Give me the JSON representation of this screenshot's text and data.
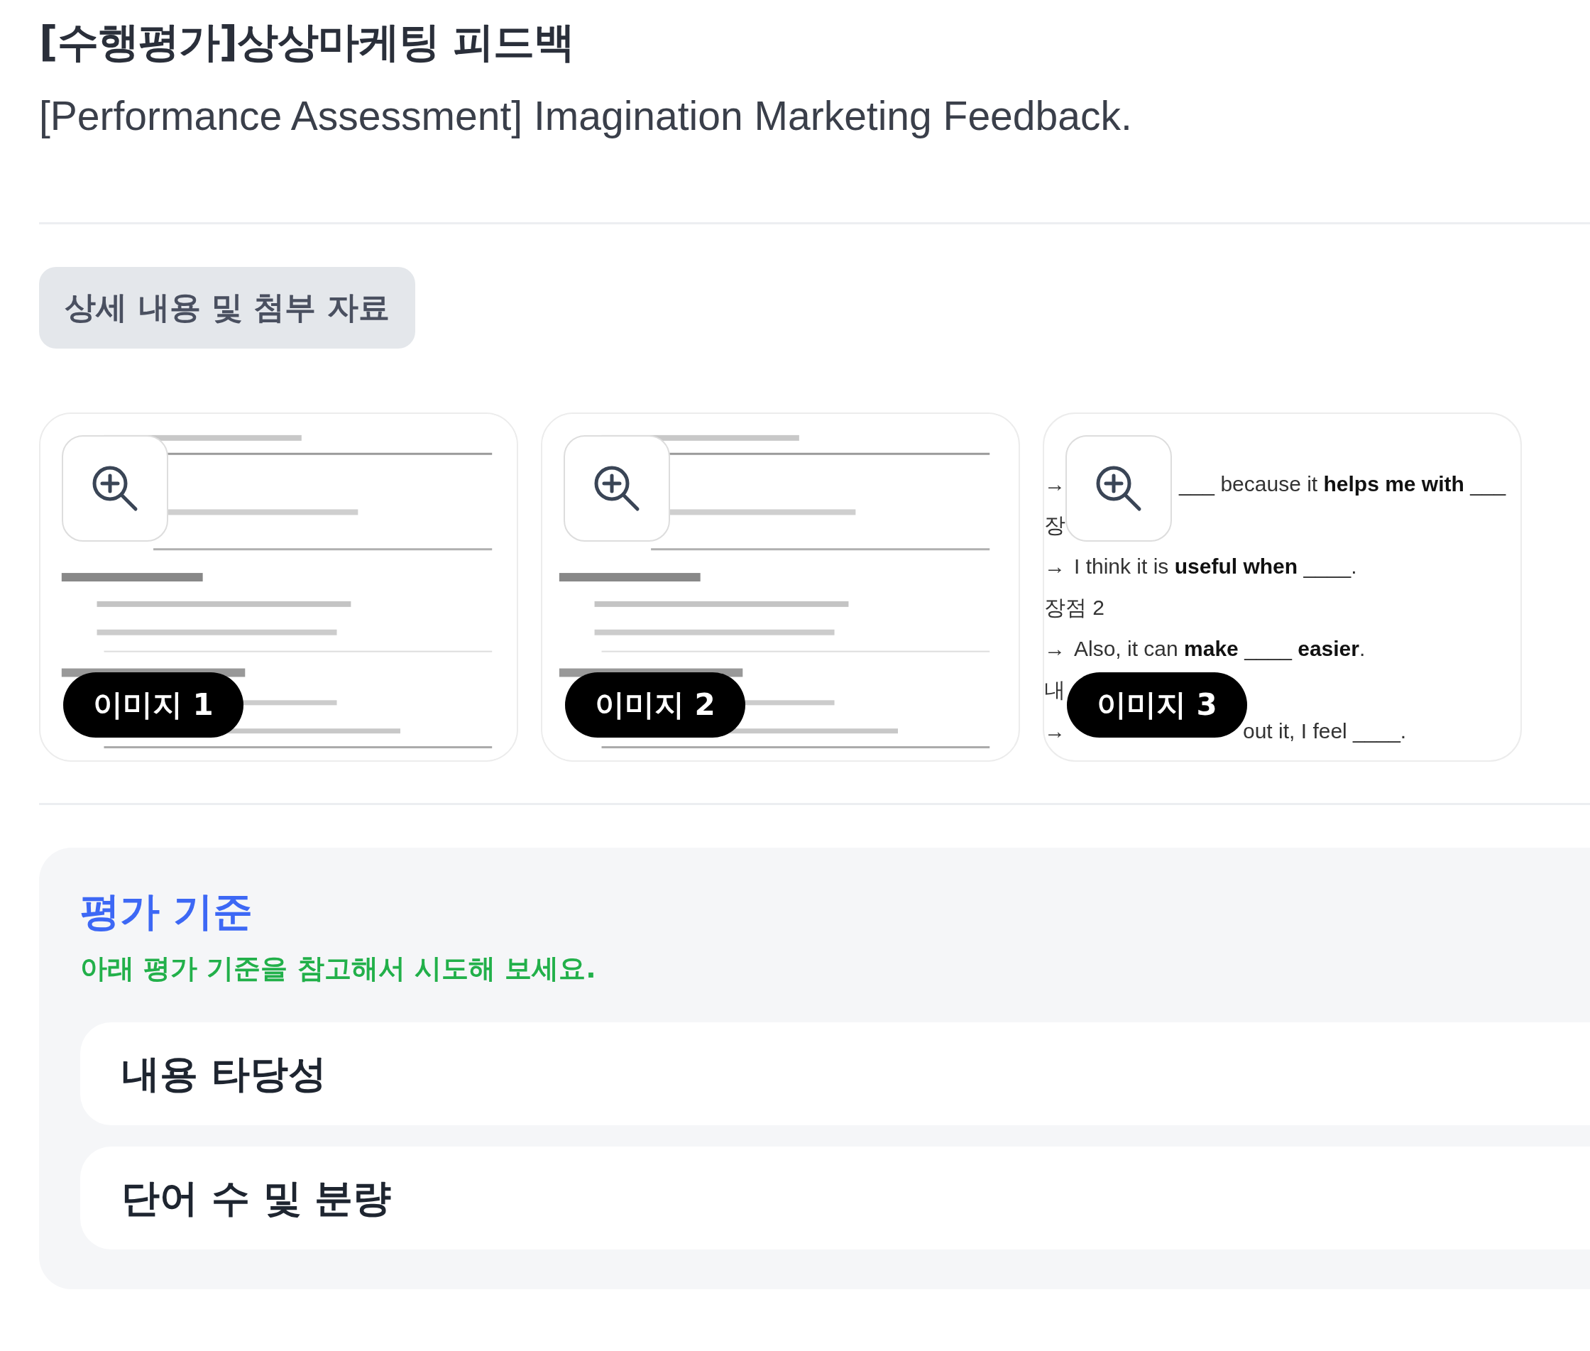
{
  "title": "[수행평가]상상마케팅 피드백",
  "subtitle": "[Performance Assessment] Imagination Marketing Feedback.",
  "details_button": "상세 내용 및 첨부 자료",
  "images": [
    {
      "kind": "picture",
      "badge": "이미지 1"
    },
    {
      "kind": "picture",
      "badge": "이미지 2"
    },
    {
      "kind": "document",
      "badge": "이미지 3",
      "lines": [
        {
          "lead": "→",
          "text": "___ because it **helps me with** ___"
        },
        {
          "lead": "장"
        },
        {
          "lead": "→",
          "text": "I think it is **useful when** ____."
        },
        {
          "lead": "장점 2"
        },
        {
          "lead": "→",
          "text": "Also, it can **make** ____ **easier**."
        },
        {
          "lead": "내"
        },
        {
          "lead": "→",
          "text": "out it, I feel ____."
        }
      ]
    }
  ],
  "criteria": {
    "heading": "평가 기준",
    "note": "아래 평가 기준을 참고해서 시도해 보세요.",
    "items": [
      "내용 타당성",
      "단어 수 및 분량"
    ]
  }
}
